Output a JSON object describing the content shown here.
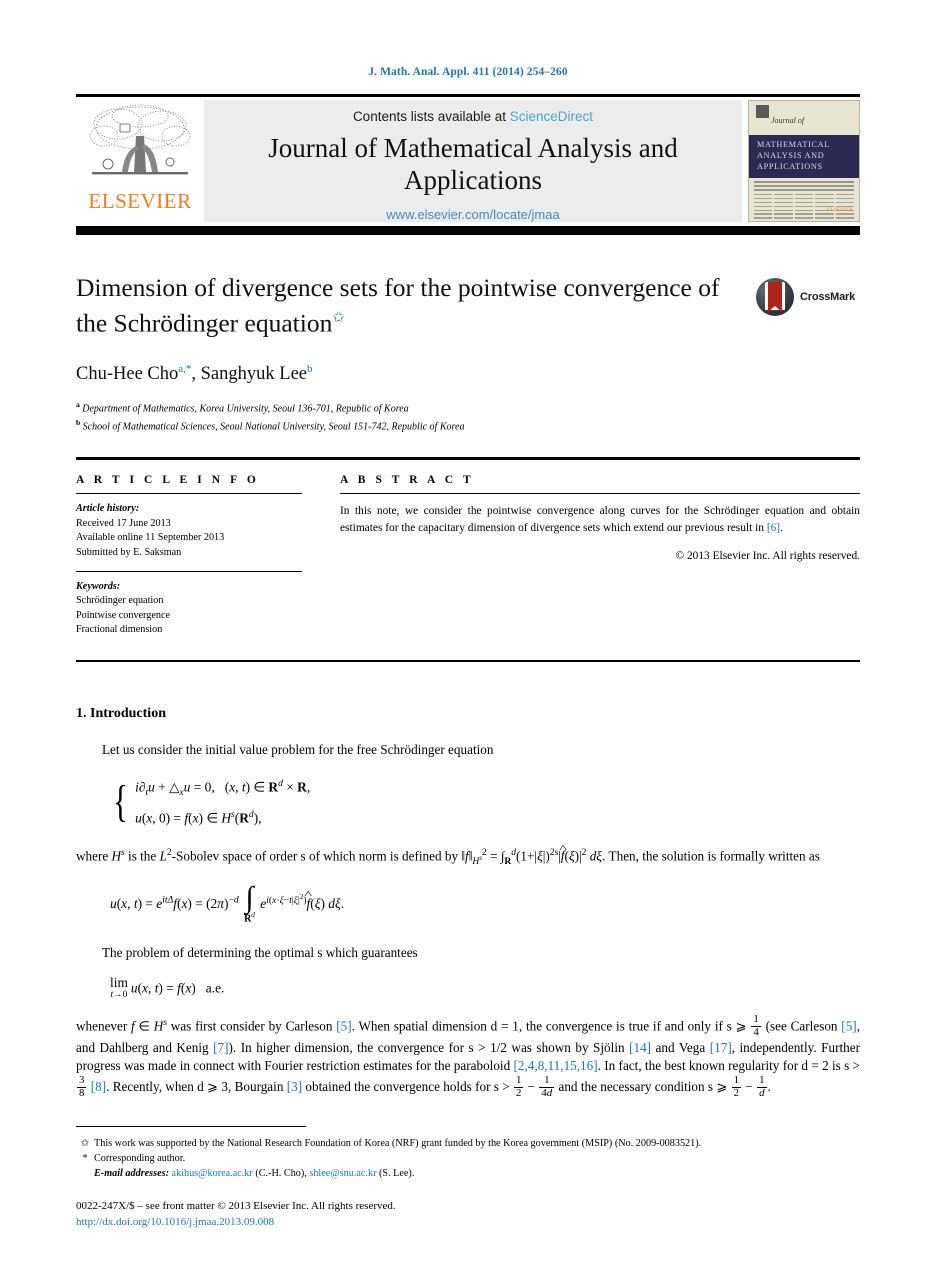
{
  "running_head": "J. Math. Anal. Appl. 411 (2014) 254–260",
  "masthead": {
    "contents_prefix": "Contents lists available at ",
    "sciencedirect": "ScienceDirect",
    "journal_title": "Journal of Mathematical Analysis and Applications",
    "journal_url": "www.elsevier.com/locate/jmaa",
    "publisher": "ELSEVIER",
    "cover": {
      "journal_of": "Journal of",
      "band_line1": "MATHEMATICAL",
      "band_line2": "ANALYSIS AND",
      "band_line3": "APPLICATIONS",
      "publisher_mark": "ELSEVIER"
    }
  },
  "article": {
    "title": "Dimension of divergence sets for the pointwise convergence of the Schrödinger equation",
    "title_footnote_mark": "✩",
    "authors": "Chu-Hee Cho, Sanghyuk Lee",
    "author_marks": {
      "first": "a,*",
      "second": "b"
    },
    "affiliations": [
      {
        "mark": "a",
        "text": "Department of Mathematics, Korea University, Seoul 136-701, Republic of Korea"
      },
      {
        "mark": "b",
        "text": "School of Mathematical Sciences, Seoul National University, Seoul 151-742, Republic of Korea"
      }
    ],
    "crossmark_label": "CrossMark"
  },
  "info": {
    "heading": "A R T I C L E    I N F O",
    "history_label": "Article history:",
    "history": [
      "Received 17 June 2013",
      "Available online 11 September 2013",
      "Submitted by E. Saksman"
    ],
    "keywords_label": "Keywords:",
    "keywords": [
      "Schrödinger equation",
      "Pointwise convergence",
      "Fractional dimension"
    ]
  },
  "abstract": {
    "heading": "A B S T R A C T",
    "text_part1": "In this note, we consider the pointwise convergence along curves for the Schrödinger equation and obtain estimates for the capacitary dimension of divergence sets which extend our previous result in ",
    "ref": "[6]",
    "text_part2": ".",
    "rights": "© 2013 Elsevier Inc. All rights reserved."
  },
  "body": {
    "section_number_title": "1. Introduction",
    "p1": "Let us consider the initial value problem for the free Schrödinger equation",
    "p2_pre": "where ",
    "p2_post": " is the ",
    "p2_tail": "-Sobolev space of order s of which norm is defined by",
    "p2_end": ". Then, the solution is formally written as",
    "p3": "The problem of determining the optimal s which guarantees",
    "p4_seg1": "whenever ",
    "p4_seg2": " was first consider by Carleson ",
    "p4_ref1": "[5]",
    "p4_seg3": ". When spatial dimension d = 1, the convergence is true if and only if s ⩾ ",
    "p4_seg4": " (see Carleson ",
    "p4_ref2": "[5]",
    "p4_seg5": ", and Dahlberg and Kenig ",
    "p4_ref3": "[7]",
    "p4_seg6": "). In higher dimension, the convergence for s > 1/2 was shown by Sjölin ",
    "p4_ref4": "[14]",
    "p4_seg7": " and Vega ",
    "p4_ref5": "[17]",
    "p4_seg8": ", independently. Further progress was made in connect with Fourier restriction estimates for the paraboloid ",
    "p4_ref6": "[2,4,8,11,15,16]",
    "p4_seg9": ". In fact, the best known regularity for d = 2 is s > ",
    "p4_ref7": "[8]",
    "p4_seg10": ". Recently, when d ⩾ 3, Bourgain ",
    "p4_ref8": "[3]",
    "p4_seg11": " obtained the convergence holds for s > ",
    "p4_seg12": " and the necessary condition s ⩾ ",
    "p4_seg13": "."
  },
  "footnotes": {
    "star_mark": "✩",
    "star_text": "This work was supported by the National Research Foundation of Korea (NRF) grant funded by the Korea government (MSIP) (No. 2009-0083521).",
    "corr_mark": "*",
    "corr_text": "Corresponding author.",
    "email_label": "E-mail addresses:",
    "email1": "akihus@korea.ac.kr",
    "email1_owner": "(C.-H. Cho)",
    "email2": "shlee@snu.ac.kr",
    "email2_owner": "(S. Lee)",
    "issn_line": "0022-247X/$ – see front matter  © 2013 Elsevier Inc. All rights reserved.",
    "doi": "http://dx.doi.org/10.1016/j.jmaa.2013.09.008"
  },
  "colors": {
    "link": "#1a7bab",
    "sciencedirect": "#4da3cc",
    "elsevier_orange": "#f07d1a",
    "masthead_bg": "#ececec",
    "cover_band": "#2c2a52"
  }
}
